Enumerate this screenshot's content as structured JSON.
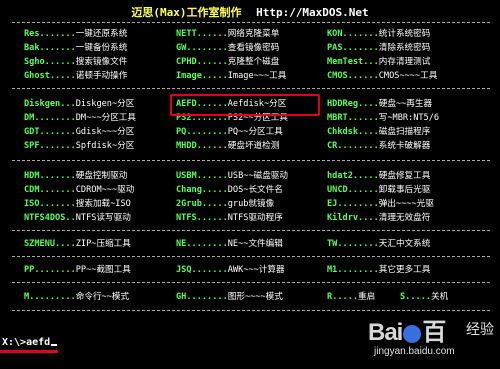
{
  "header": {
    "title_cn": "迈思(Max)工作室制作",
    "url": "Http://MaxDOS.Net"
  },
  "rows": [
    [
      {
        "key": "Res.......",
        "value": "一键还原系统"
      },
      {
        "key": "NETT......",
        "value": "网络克隆菜单"
      },
      {
        "key": "KON.......",
        "value": "统计系统密码"
      }
    ],
    [
      {
        "key": "Bak.......",
        "value": "一键备份系统"
      },
      {
        "key": "GW........",
        "value": "查看镜像密码"
      },
      {
        "key": "PAS.......",
        "value": "清除系统密码"
      }
    ],
    [
      {
        "key": "Sgho......",
        "value": "搜索镜像文件"
      },
      {
        "key": "CPHD......",
        "value": "克隆整个磁盘"
      },
      {
        "key": "MemTest...",
        "value": "内存清理测试"
      }
    ],
    [
      {
        "key": "Ghost.....",
        "value": "诺顿手动操作"
      },
      {
        "key": "Image.....",
        "value": "Image~~~工具"
      },
      {
        "key": "CMOS......",
        "value": "CMOS~~~~工具"
      }
    ],
    [
      {
        "key": "Diskgen...",
        "value": "Diskgen~分区"
      },
      {
        "key": "AEFD......",
        "value": "Aefdisk~分区"
      },
      {
        "key": "HDDReg....",
        "value": "硬盘~~再生器"
      }
    ],
    [
      {
        "key": "DM........",
        "value": "DM~~~分区工具"
      },
      {
        "key": "PS2.......",
        "value": "PS2~~分区工具"
      },
      {
        "key": "MBRT......",
        "value": "写~MBR:NT5/6"
      }
    ],
    [
      {
        "key": "GDT.......",
        "value": "Gdisk~~~分区"
      },
      {
        "key": "PQ........",
        "value": "PQ~~分区工具"
      },
      {
        "key": "Chkdsk....",
        "value": "磁盘扫描程序"
      }
    ],
    [
      {
        "key": "SPF.......",
        "value": "Spfdisk~分区"
      },
      {
        "key": "MHDD......",
        "value": "硬盘坏道检测"
      },
      {
        "key": "CR........",
        "value": "系统卡破解器"
      }
    ],
    [
      {
        "key": "HDM.......",
        "value": "硬盘控制驱动"
      },
      {
        "key": "USBM......",
        "value": "USB~~磁盘驱动"
      },
      {
        "key": "hdat2.....",
        "value": "硬盘修复工具"
      }
    ],
    [
      {
        "key": "CDM.......",
        "value": "CDROM~~~驱动"
      },
      {
        "key": "Chang.....",
        "value": "DOS~长文件名"
      },
      {
        "key": "UNCD......",
        "value": "卸载事后光驱"
      }
    ],
    [
      {
        "key": "ISO.......",
        "value": "搜索加载~ISO"
      },
      {
        "key": "2Grub.....",
        "value": "grub就镜像"
      },
      {
        "key": "EJ........",
        "value": "弹出~~~~光驱"
      }
    ],
    [
      {
        "key": "NTFS4DOS..",
        "value": "NTFS读写驱动"
      },
      {
        "key": "NTFS......",
        "value": "NTFS驱动程序"
      },
      {
        "key": "Kildrv....",
        "value": "清理无效盘符"
      }
    ],
    [
      {
        "key": "SZMENU....",
        "value": "ZIP~压缩工具"
      },
      {
        "key": "NE........",
        "value": "NE~~文件编辑"
      },
      {
        "key": "TW........",
        "value": "天汇中文系统"
      }
    ],
    [
      {
        "key": "PP........",
        "value": "PP~~截图工具"
      },
      {
        "key": "JSQ.......",
        "value": "AWK~~~计算器"
      },
      {
        "key": "M1........",
        "value": "其它更多工具"
      }
    ],
    [
      {
        "key": "M.........",
        "value": "命令行~~模式"
      },
      {
        "key": "GH........",
        "value": "图形~~~~模式"
      },
      {
        "key": "R.....",
        "value": "重启"
      },
      {
        "key": "S.....",
        "value": "关机"
      }
    ]
  ],
  "prompt": {
    "text": "X:\\>aefd"
  },
  "watermark": {
    "logo": "Bai",
    "logo2": "百",
    "jingyan": "经验",
    "url": "jingyan.baidu.com"
  },
  "colors": {
    "key": "#55ff55",
    "value": "#ffffff",
    "highlight": "#e0001a",
    "title": "#ffff55"
  }
}
